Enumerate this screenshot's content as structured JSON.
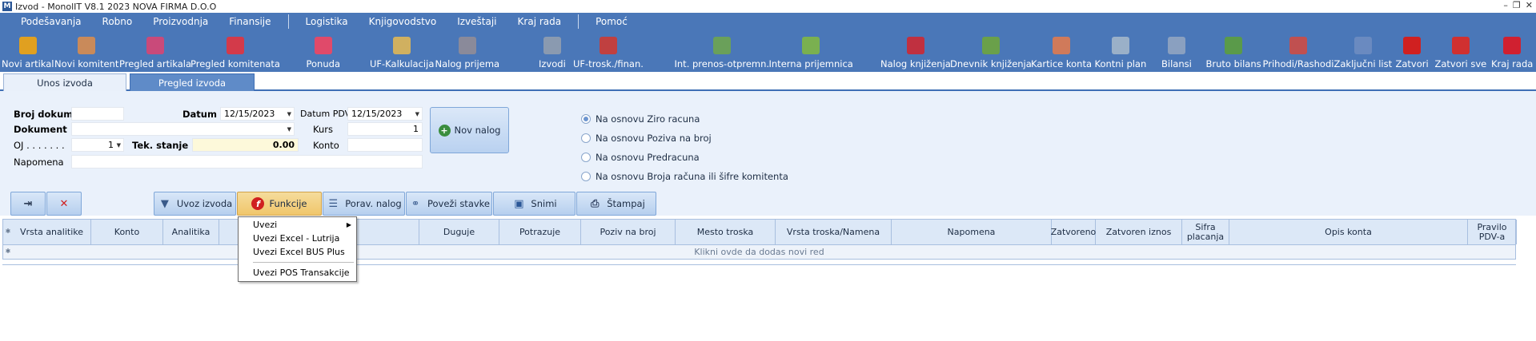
{
  "window": {
    "title": "Izvod - MonolIT V8.1 2023 NOVA FIRMA D.O.O",
    "controls": [
      "–",
      "❐",
      "✕"
    ]
  },
  "menu": [
    "Podešavanja",
    "Robno",
    "Proizvodnja",
    "Finansije",
    "Logistika",
    "Knjigovodstvo",
    "Izveštaji",
    "Kraj rada",
    "Pomoć"
  ],
  "toolbar": [
    {
      "label": "Novi artikal",
      "icon": "new-article-icon",
      "color": "#e0a020"
    },
    {
      "label": "Novi komitent",
      "icon": "new-client-icon",
      "color": "#c98a5a"
    },
    {
      "label": "Pregled artikala",
      "icon": "articles-icon",
      "color": "#c94a7a"
    },
    {
      "label": "Pregled komitenata",
      "icon": "clients-icon",
      "color": "#d33a4a"
    },
    {
      "label": "Ponuda",
      "icon": "offer-icon",
      "color": "#e04a6a"
    },
    {
      "label": "UF-Kalkulacija",
      "icon": "calculation-icon",
      "color": "#d0b060"
    },
    {
      "label": "Nalog prijema",
      "icon": "receipt-order-icon",
      "color": "#8a8a9a"
    },
    {
      "label": "Izvodi",
      "icon": "statements-icon",
      "color": "#8a9ab0"
    },
    {
      "label": "UF-trosk./finan.",
      "icon": "costs-icon",
      "color": "#c04040"
    },
    {
      "label": "Int. prenos-otpremn.",
      "icon": "transfer-icon",
      "color": "#6aa05a"
    },
    {
      "label": "Interna prijemnica",
      "icon": "internal-receipt-icon",
      "color": "#7ab050"
    },
    {
      "label": "Nalog knjiženja",
      "icon": "posting-order-icon",
      "color": "#c03040"
    },
    {
      "label": "Dnevnik knjiženja",
      "icon": "journal-icon",
      "color": "#6aa04a"
    },
    {
      "label": "Kartice konta",
      "icon": "account-cards-icon",
      "color": "#d07a5a"
    },
    {
      "label": "Kontni plan",
      "icon": "chart-of-accounts-icon",
      "color": "#9ab0c8"
    },
    {
      "label": "Bilansi",
      "icon": "balances-icon",
      "color": "#8aa0c0"
    },
    {
      "label": "Bruto bilans",
      "icon": "gross-balance-icon",
      "color": "#5a9a4a"
    },
    {
      "label": "Prihodi/Rashodi",
      "icon": "income-expense-icon",
      "color": "#c05050"
    },
    {
      "label": "Zaključni list",
      "icon": "closing-sheet-icon",
      "color": "#6a8ac0"
    },
    {
      "label": "Zatvori",
      "icon": "close-x-icon",
      "color": "#d02020"
    },
    {
      "label": "Zatvori sve",
      "icon": "close-all-icon",
      "color": "#d03030"
    },
    {
      "label": "Kraj rada",
      "icon": "power-icon",
      "color": "#d02030"
    }
  ],
  "tabs": {
    "active": "Unos izvoda",
    "inactive": "Pregled izvoda"
  },
  "form": {
    "broj_dokum_label": "Broj dokum.",
    "broj_dokum_value": "",
    "datum_label": "Datum",
    "datum_value": "12/15/2023",
    "datum_pdv_label": "Datum PDV",
    "datum_pdv_value": "12/15/2023",
    "dokument_label": "Dokument",
    "dokument_value": "",
    "kurs_label": "Kurs",
    "kurs_value": "1",
    "oj_label": "OJ . . . . . . .",
    "oj_value": "1",
    "tek_stanje_label": "Tek. stanje",
    "tek_stanje_value": "0.00",
    "konto_label": "Konto",
    "konto_value": "",
    "napomena_label": "Napomena",
    "napomena_value": "",
    "nov_nalog_label": "Nov nalog"
  },
  "radios": [
    {
      "label": "Na osnovu Ziro racuna",
      "checked": true
    },
    {
      "label": "Na osnovu Poziva na broj",
      "checked": false
    },
    {
      "label": "Na osnovu Predracuna",
      "checked": false
    },
    {
      "label": "Na osnovu Broja računa ili šifre komitenta",
      "checked": false
    }
  ],
  "actions": {
    "uvoz_izvoda": "Uvoz izvoda",
    "funkcije": "Funkcije",
    "porav_nalog": "Porav. nalog",
    "povezi_stavke": "Poveži stavke",
    "snimi": "Snimi",
    "stampaj": "Štampaj"
  },
  "grid": {
    "columns": [
      "Vrsta analitike",
      "Konto",
      "Analitika",
      "",
      "Duguje",
      "Potrazuje",
      "Poziv na broj",
      "Mesto troska",
      "Vrsta troska/Namena",
      "Napomena",
      "Zatvoreno",
      "Zatvoren iznos",
      "Sifra placanja",
      "Opis konta",
      "Pravilo PDV-a"
    ],
    "new_row_hint": "Klikni ovde da dodas novi red"
  },
  "dropdown": {
    "items": [
      "Uvezi",
      "Uvezi Excel - Lutrija",
      "Uvezi Excel BUS Plus",
      "Uvezi POS Transakcije"
    ]
  }
}
